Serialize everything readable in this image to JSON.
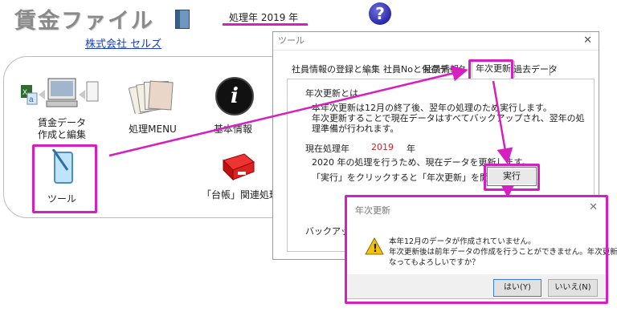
{
  "app": {
    "title": "賃金ファイル",
    "year_label": "処理年 2019 年",
    "help_glyph": "?",
    "company": "株式会社 セルズ"
  },
  "menu": {
    "items": [
      {
        "label_line1": "賃金データ",
        "label_line2": "作成と編集"
      },
      {
        "label": "処理MENU"
      },
      {
        "label": "基本情報"
      },
      {
        "label": "ツール"
      },
      {
        "label": "「台帳」関連処理"
      }
    ]
  },
  "tool_window": {
    "title": "ツール",
    "close_glyph": "✕",
    "tabs": [
      "社員情報の登録と編集",
      "社員Noと保存データ",
      "社員情報",
      "年次更新",
      "過去データ"
    ],
    "section_heading": "年次更新とは",
    "desc_line1": "本年次更新は12月の終了後、翌年の処理のため実行します。",
    "desc_line2": "年次更新することで現在データはすべてバックアップされ、翌年の処",
    "desc_line3": "理準備が行われます。",
    "current_label": "現在処理年",
    "current_year": "2019",
    "current_unit": "年",
    "process_note": "2020 年の処理を行うため、現在データを更新します。",
    "click_note": "「実行」をクリックすると「年次更新」を開始します。",
    "exec_label": "実行",
    "backup_label": "バックアップデー"
  },
  "confirm_dialog": {
    "title": "年次更新",
    "close_glyph": "✕",
    "warning_glyph": "!",
    "line1": "本年12月のデータが作成されていません。",
    "line2": "年次更新後は前年データの作成を行うことができません。年次更新をおこ",
    "line3": "なってもよろしいですか？",
    "yes_label": "はい(Y)",
    "no_label": "いいえ(N)"
  },
  "colors": {
    "highlight": "#d61fc0",
    "link": "#1a3fb5",
    "year_red": "#d0202a"
  }
}
